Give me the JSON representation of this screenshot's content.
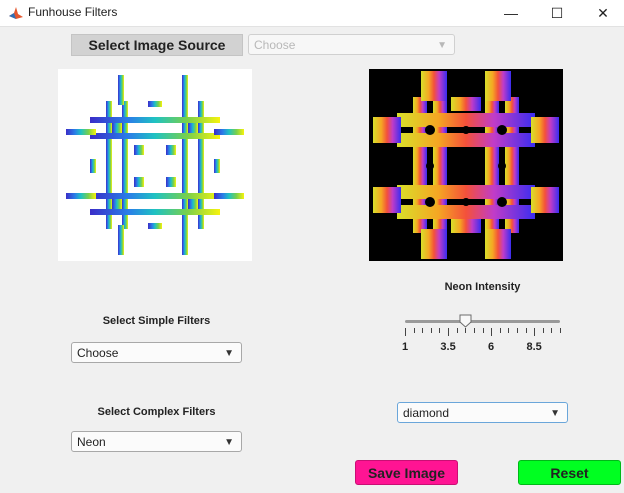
{
  "window": {
    "title": "Funhouse Filters",
    "minimize_glyph": "—",
    "maximize_glyph": "☐",
    "close_glyph": "✕"
  },
  "source": {
    "button_label": "Select Image Source",
    "dropdown_value": "Choose"
  },
  "neon": {
    "label": "Neon Intensity",
    "slider_value": 4.5,
    "slider_min": 1,
    "slider_max": 10,
    "tick_labels": [
      "1",
      "3.5",
      "6",
      "8.5"
    ],
    "pattern_value": "diamond"
  },
  "simple_filters": {
    "label": "Select Simple Filters",
    "value": "Choose"
  },
  "complex_filters": {
    "label": "Select Complex Filters",
    "value": "Neon"
  },
  "actions": {
    "save_label": "Save Image",
    "reset_label": "Reset"
  },
  "colors": {
    "save_button": "#ff1493",
    "reset_button": "#00ff21",
    "neon_background": "#000000"
  }
}
